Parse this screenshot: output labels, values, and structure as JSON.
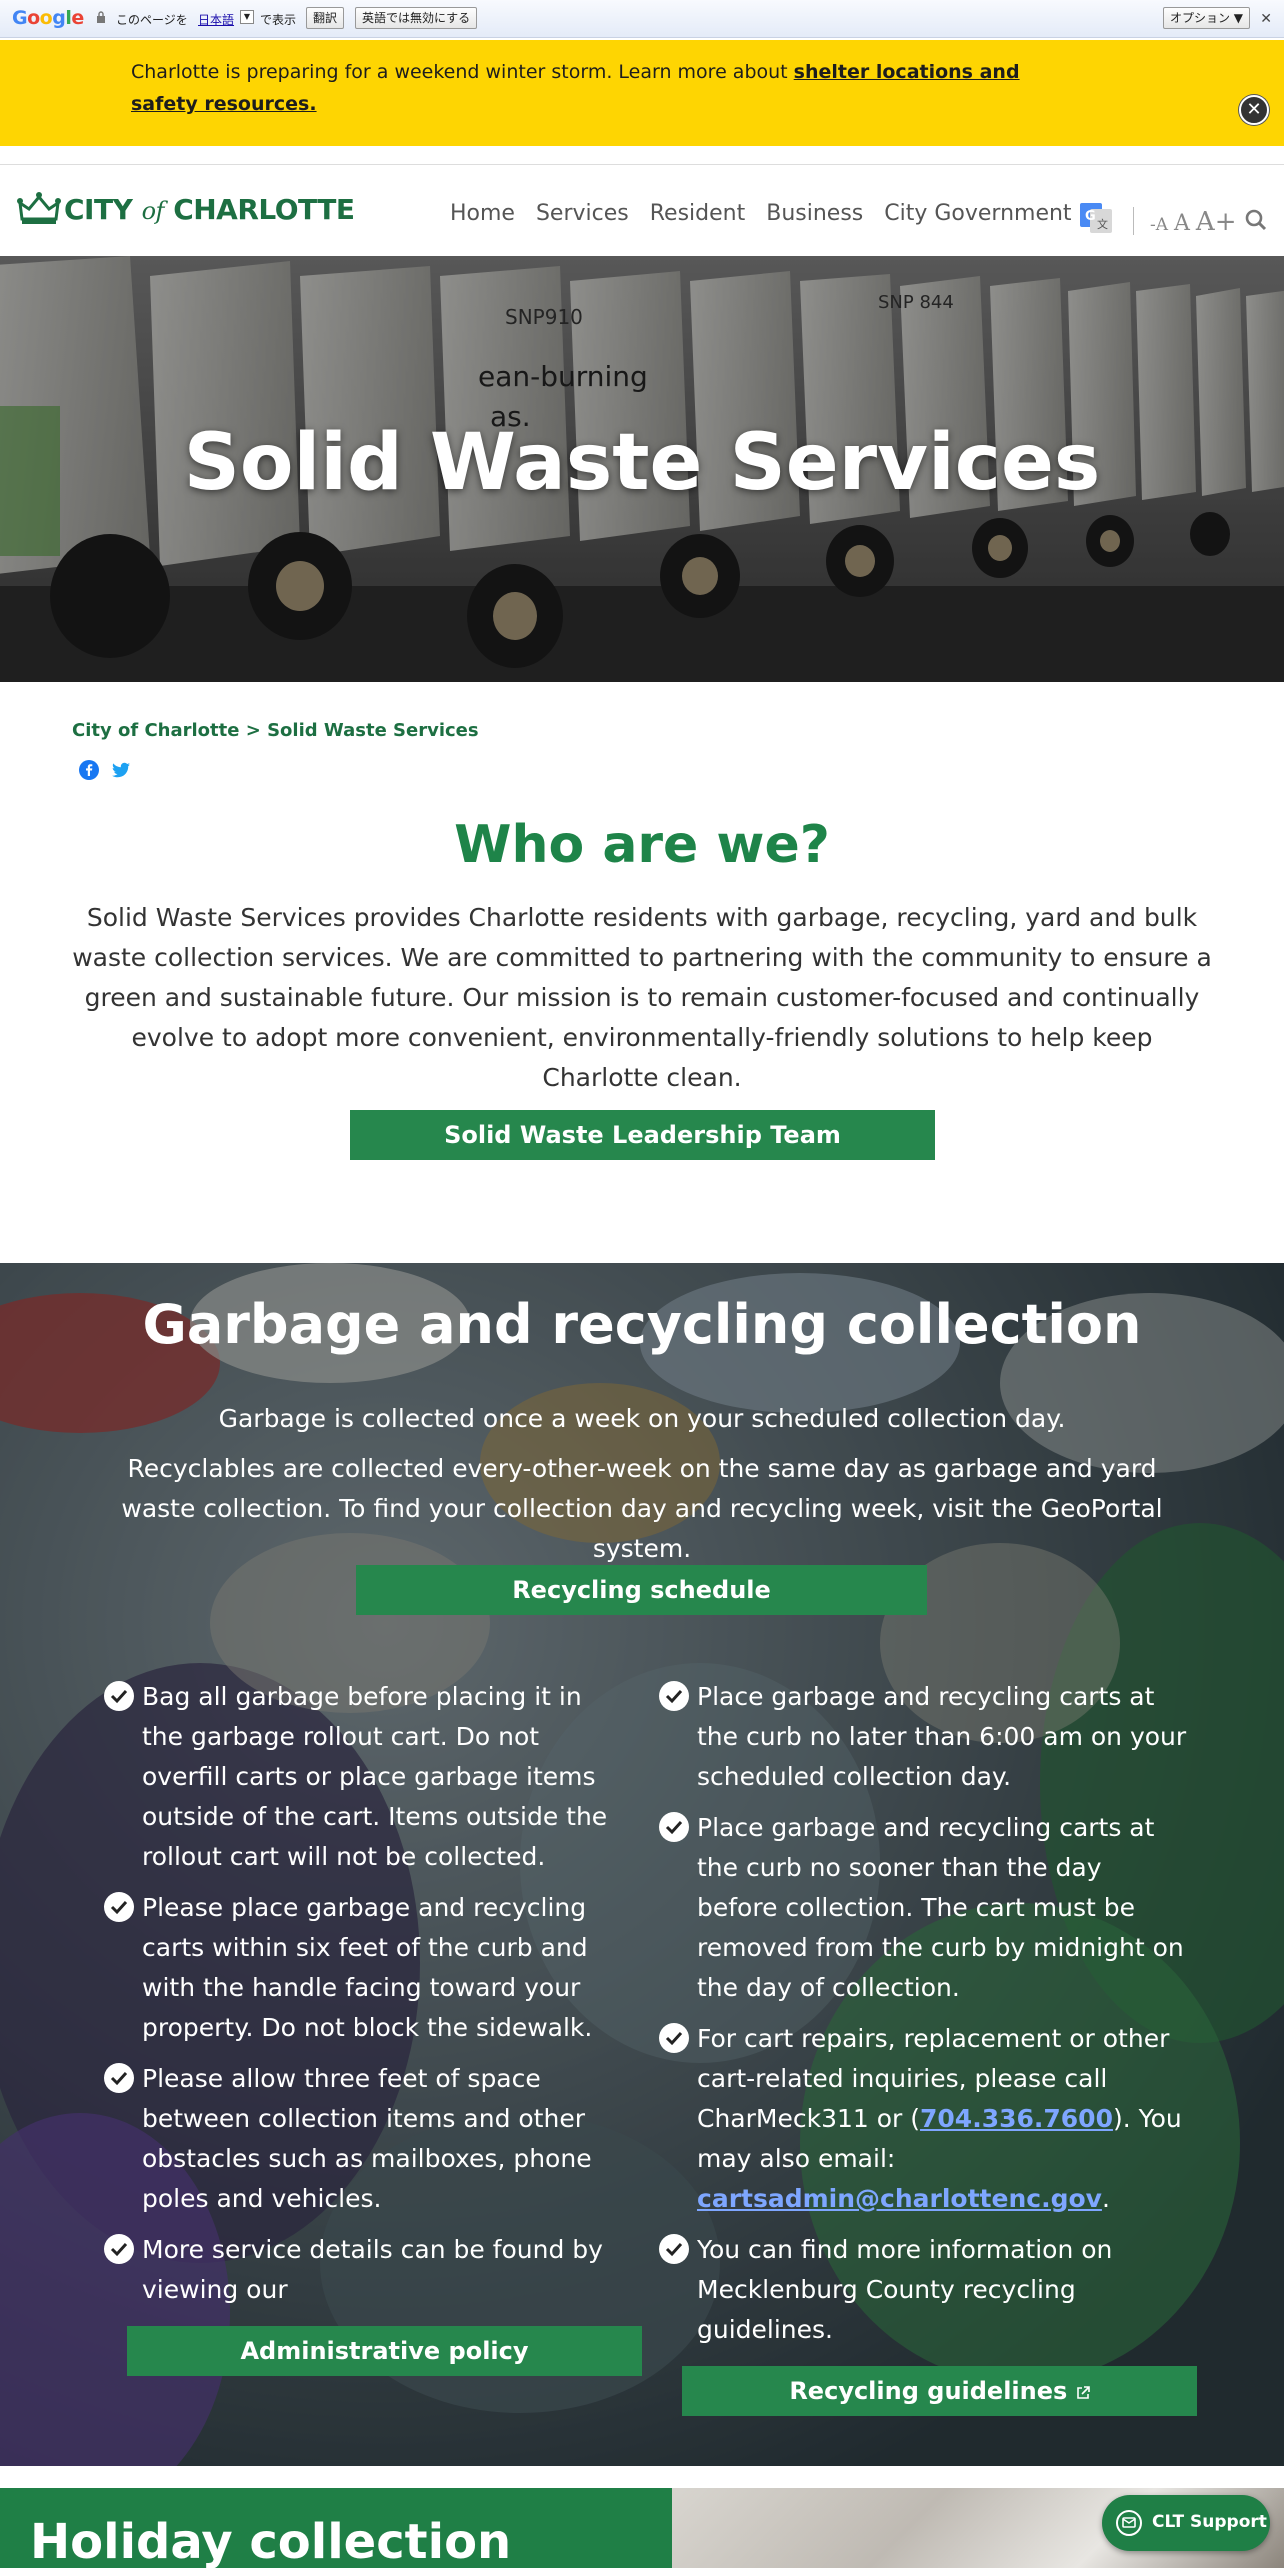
{
  "translate_bar": {
    "logo": "Google",
    "text_before_lang": "このページを",
    "language": "日本語",
    "text_after_lang": "で表示",
    "translate_button": "翻訳",
    "disable_button": "英語では無効にする",
    "options_button": "オプション ▼",
    "close_glyph": "✕"
  },
  "alert": {
    "text": "Charlotte is preparing for a weekend winter storm. Learn more about ",
    "link": "shelter locations and safety resources.",
    "close_glyph": "✕"
  },
  "header": {
    "logo_city": "CITY",
    "logo_of": "of",
    "logo_charlotte": "CHARLOTTE",
    "nav": [
      "Home",
      "Services",
      "Resident",
      "Business",
      "City Government"
    ],
    "font_small": "-A",
    "font_mid": "A",
    "font_large": "A+"
  },
  "hero": {
    "title": "Solid Waste Services",
    "truck_labels": [
      "SNP910",
      "ean-burning",
      "as.",
      "SNP 844"
    ]
  },
  "breadcrumb": {
    "home": "City of Charlotte",
    "separator": " > ",
    "current": "Solid Waste Services"
  },
  "who": {
    "title": "Who are we?",
    "body": "Solid Waste Services provides Charlotte residents with garbage, recycling, yard and bulk waste collection services. We are committed to partnering with the community to ensure a green and sustainable future. Our mission is to remain customer-focused and continually evolve to adopt more convenient, environmentally-friendly solutions to help keep Charlotte clean.",
    "button": "Solid Waste Leadership Team"
  },
  "garbage": {
    "title": "Garbage and recycling collection",
    "intro_1": "Garbage is collected once a week on your scheduled collection day.",
    "intro_2": "Recyclables are collected every-other-week on the same day as garbage and yard waste collection. To find your collection day and recycling week, visit the GeoPortal system.",
    "schedule_button": "Recycling schedule",
    "left_items": [
      "Bag all garbage before placing it in the garbage rollout cart. Do not overfill carts or place garbage items outside of the cart. Items outside the rollout cart will not be collected.",
      "Please place garbage and recycling carts within six feet of the curb and with the handle facing toward your property. Do not block the sidewalk.",
      "Please allow three feet of space between collection items and other obstacles such as mailboxes, phone poles and vehicles.",
      "More service details can be found by viewing our"
    ],
    "right_items": [
      "Place garbage and recycling carts at the curb no later than 6:00 am on your scheduled collection day.",
      "Place garbage and recycling carts at the curb no sooner than the day before collection. The cart must be removed from the curb by midnight on the day of collection."
    ],
    "cart_item": {
      "before": "For cart repairs, replacement or other cart-related inquiries, please call CharMeck311 or (",
      "phone": "704.336.7600",
      "middle": "). You may also email: ",
      "email": "cartsadmin@charlottenc.gov",
      "after": "."
    },
    "county_item": "You can find more information on Mecklenburg County recycling guidelines.",
    "admin_button": "Administrative policy",
    "guidelines_button": "Recycling guidelines"
  },
  "holiday": {
    "title": "Holiday collection"
  },
  "support": {
    "label": "CLT Support"
  }
}
